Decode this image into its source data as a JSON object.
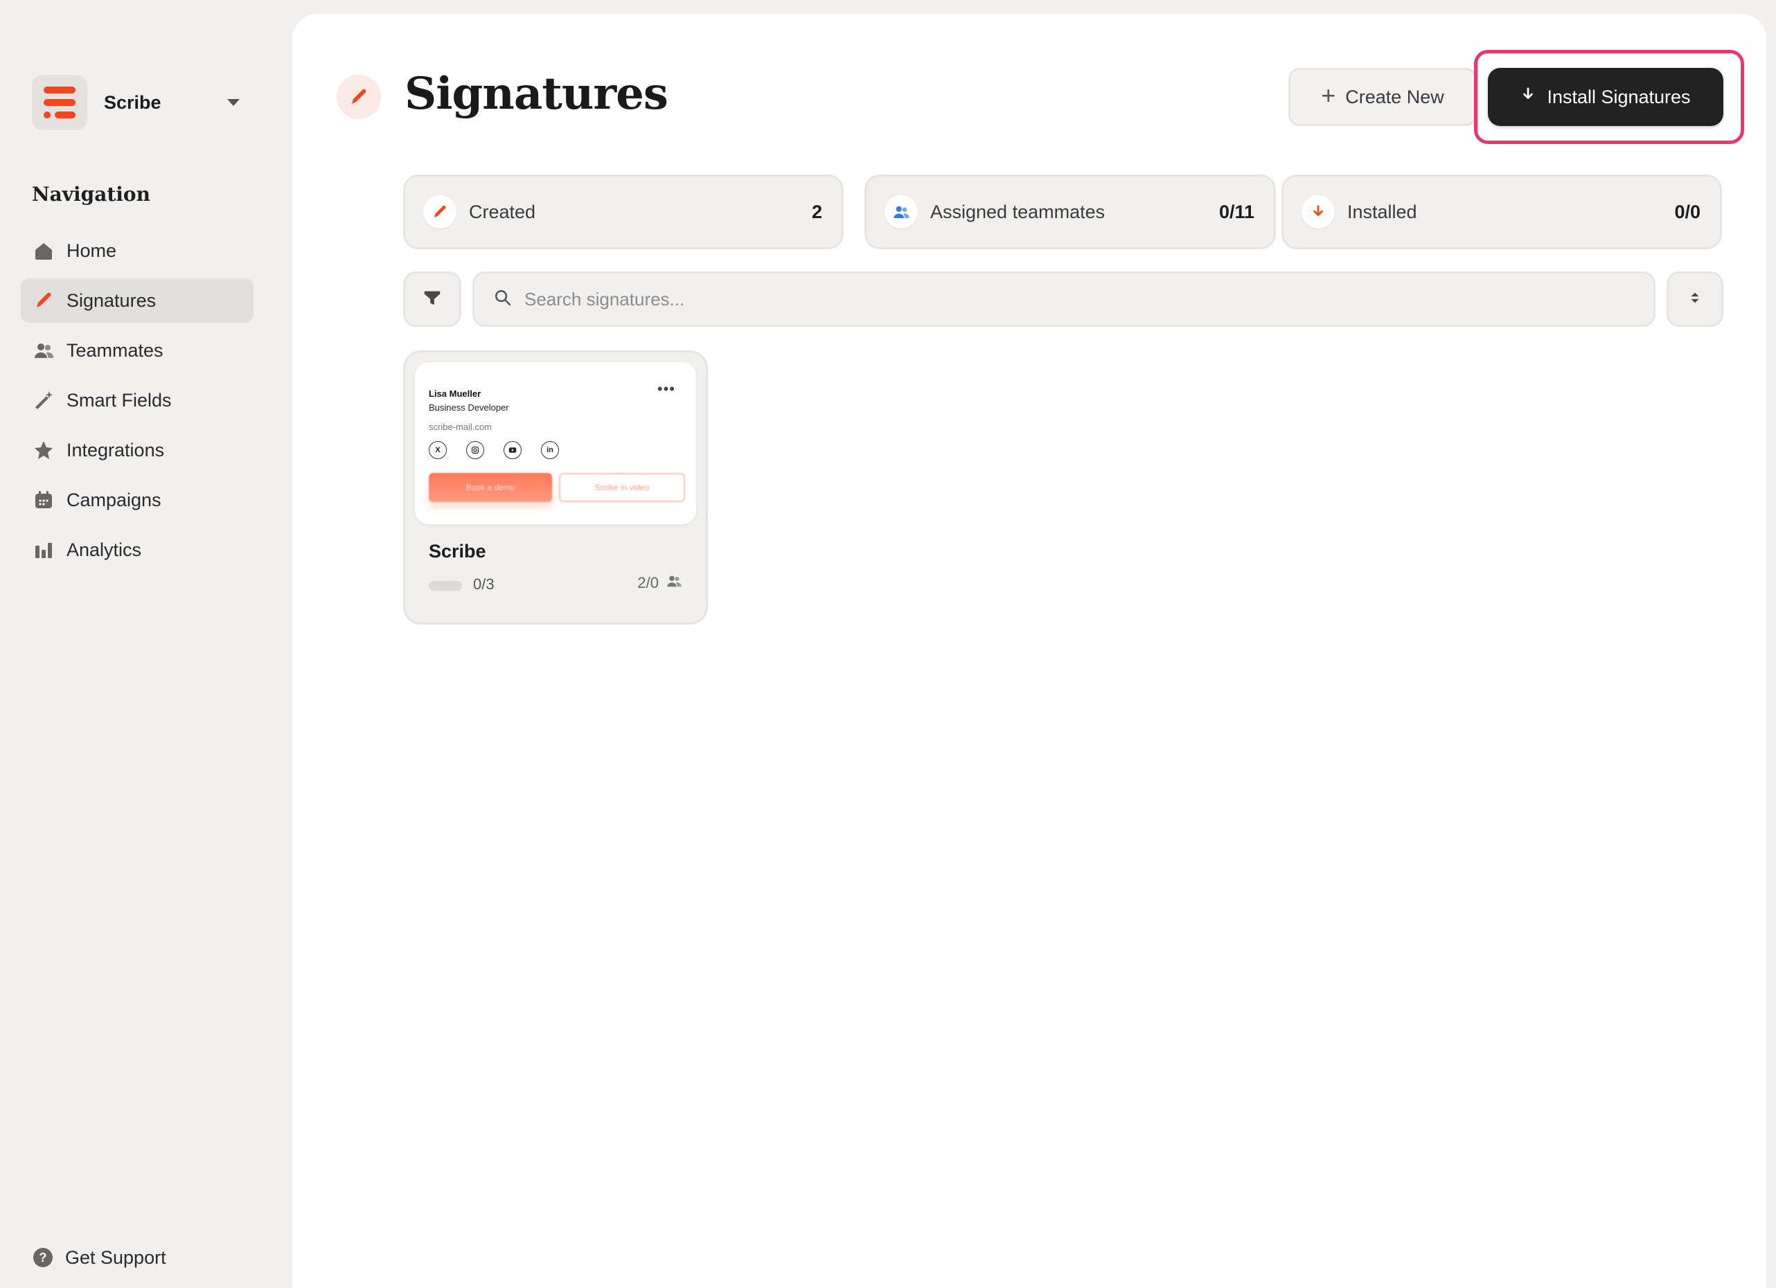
{
  "workspace": {
    "name": "Scribe"
  },
  "sidebar": {
    "title": "Navigation",
    "items": [
      {
        "label": "Home"
      },
      {
        "label": "Signatures"
      },
      {
        "label": "Teammates"
      },
      {
        "label": "Smart Fields"
      },
      {
        "label": "Integrations"
      },
      {
        "label": "Campaigns"
      },
      {
        "label": "Analytics"
      }
    ],
    "active_index": 1,
    "support_label": "Get Support"
  },
  "header": {
    "title": "Signatures",
    "create_label": "Create New",
    "install_label": "Install Signatures"
  },
  "stats": [
    {
      "label": "Created",
      "value": "2"
    },
    {
      "label": "Assigned teammates",
      "value": "0/11"
    },
    {
      "label": "Installed",
      "value": "0/0"
    }
  ],
  "search": {
    "placeholder": "Search signatures..."
  },
  "cards": [
    {
      "title": "Scribe",
      "count": "0/3",
      "team": "2/0",
      "preview": {
        "name": "Lisa Mueller",
        "role": "Business Developer",
        "site": "scribe-mail.com",
        "cta_primary": "Book a demo",
        "cta_secondary": "Scribe in video",
        "social": [
          "x-icon",
          "instagram-icon",
          "youtube-icon",
          "linkedin-icon"
        ]
      }
    }
  ],
  "colors": {
    "accent": "#f5451d",
    "highlight": "#e8386a",
    "install_button": "#222222",
    "assigned_icon": "#2f7de1"
  }
}
